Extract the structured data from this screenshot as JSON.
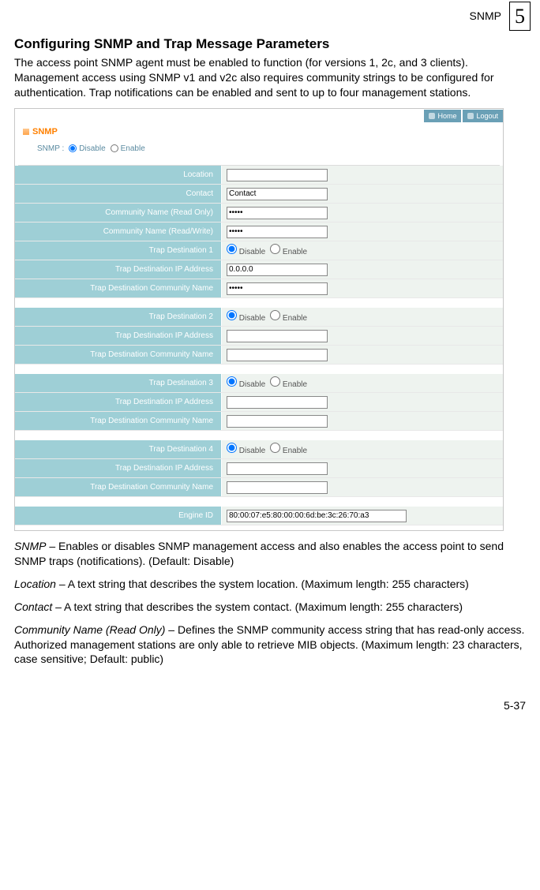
{
  "header": {
    "breadcrumb": "SNMP",
    "chapter": "5"
  },
  "section": {
    "title": "Configuring SNMP and Trap Message Parameters",
    "intro": "The access point  SNMP agent must be enabled to function (for versions 1, 2c, and 3 clients). Management access using SNMP v1 and v2c also requires community strings to be configured for authentication. Trap notifications can be enabled and sent to up to four management stations."
  },
  "ui": {
    "topbar": {
      "home": "Home",
      "logout": "Logout"
    },
    "brand": "SNMP",
    "snmpRow": {
      "label": "SNMP :",
      "disable": "Disable",
      "enable": "Enable"
    },
    "rows": {
      "location": {
        "label": "Location",
        "value": ""
      },
      "contact": {
        "label": "Contact",
        "value": "Contact"
      },
      "commRO": {
        "label": "Community Name (Read Only)",
        "value": "*****"
      },
      "commRW": {
        "label": "Community Name (Read/Write)",
        "value": "*****"
      },
      "trap1": {
        "dest": "Trap Destination 1",
        "ip": "Trap Destination IP Address",
        "ipval": "0.0.0.0",
        "comm": "Trap Destination Community Name",
        "commval": "*****"
      },
      "trap2": {
        "dest": "Trap Destination 2",
        "ip": "Trap Destination IP Address",
        "ipval": "",
        "comm": "Trap Destination Community Name",
        "commval": ""
      },
      "trap3": {
        "dest": "Trap Destination 3",
        "ip": "Trap Destination IP Address",
        "ipval": "",
        "comm": "Trap Destination Community Name",
        "commval": ""
      },
      "trap4": {
        "dest": "Trap Destination 4",
        "ip": "Trap Destination IP Address",
        "ipval": "",
        "comm": "Trap Destination Community Name",
        "commval": ""
      },
      "engine": {
        "label": "Engine ID",
        "value": "80:00:07:e5:80:00:00:6d:be:3c:26:70:a3"
      },
      "opt": {
        "disable": "Disable",
        "enable": "Enable"
      }
    }
  },
  "defs": {
    "snmp": {
      "term": "SNMP",
      "text": " – Enables or disables SNMP management access and also enables the access point to send SNMP traps (notifications). (Default: Disable)"
    },
    "location": {
      "term": "Location",
      "text": " – A text string that describes the system location. (Maximum length: 255 characters)"
    },
    "contact": {
      "term": "Contact",
      "text": " – A text string that describes the system contact. (Maximum length: 255 characters)"
    },
    "commRO": {
      "term": "Community Name (Read Only)",
      "text": " – Defines the SNMP community access string that has read-only access. Authorized management stations are only able to retrieve MIB objects. (Maximum length: 23 characters, case sensitive; Default: public)"
    }
  },
  "footer": {
    "page": "5-37"
  }
}
